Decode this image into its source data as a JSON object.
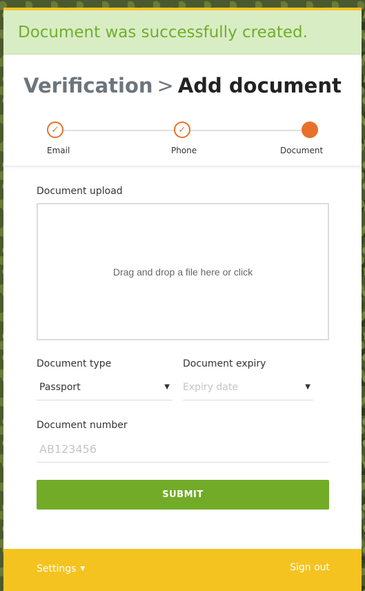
{
  "alert": {
    "message": "Document was successfully created."
  },
  "header": {
    "breadcrumb_parent": "Verification",
    "separator": ">",
    "breadcrumb_current": "Add document"
  },
  "stepper": {
    "steps": [
      {
        "label": "Email",
        "status": "done"
      },
      {
        "label": "Phone",
        "status": "done"
      },
      {
        "label": "Document",
        "status": "active"
      }
    ],
    "check_glyph": "✓"
  },
  "form": {
    "upload_label": "Document upload",
    "dropzone_text": "Drag and drop a file here or click",
    "type_label": "Document type",
    "type_value": "Passport",
    "expiry_label": "Document expiry",
    "expiry_placeholder": "Expiry date",
    "number_label": "Document number",
    "number_placeholder": "AB123456",
    "submit_label": "SUBMIT"
  },
  "footer": {
    "settings_label": "Settings",
    "signout_label": "Sign out"
  },
  "colors": {
    "accent_orange": "#e8702a",
    "brand_yellow": "#f5c320",
    "submit_green": "#72ab28",
    "alert_green": "#6fae2a"
  },
  "icons": {
    "step_done": "check-circle-icon",
    "dropdown": "chevron-down-icon"
  }
}
